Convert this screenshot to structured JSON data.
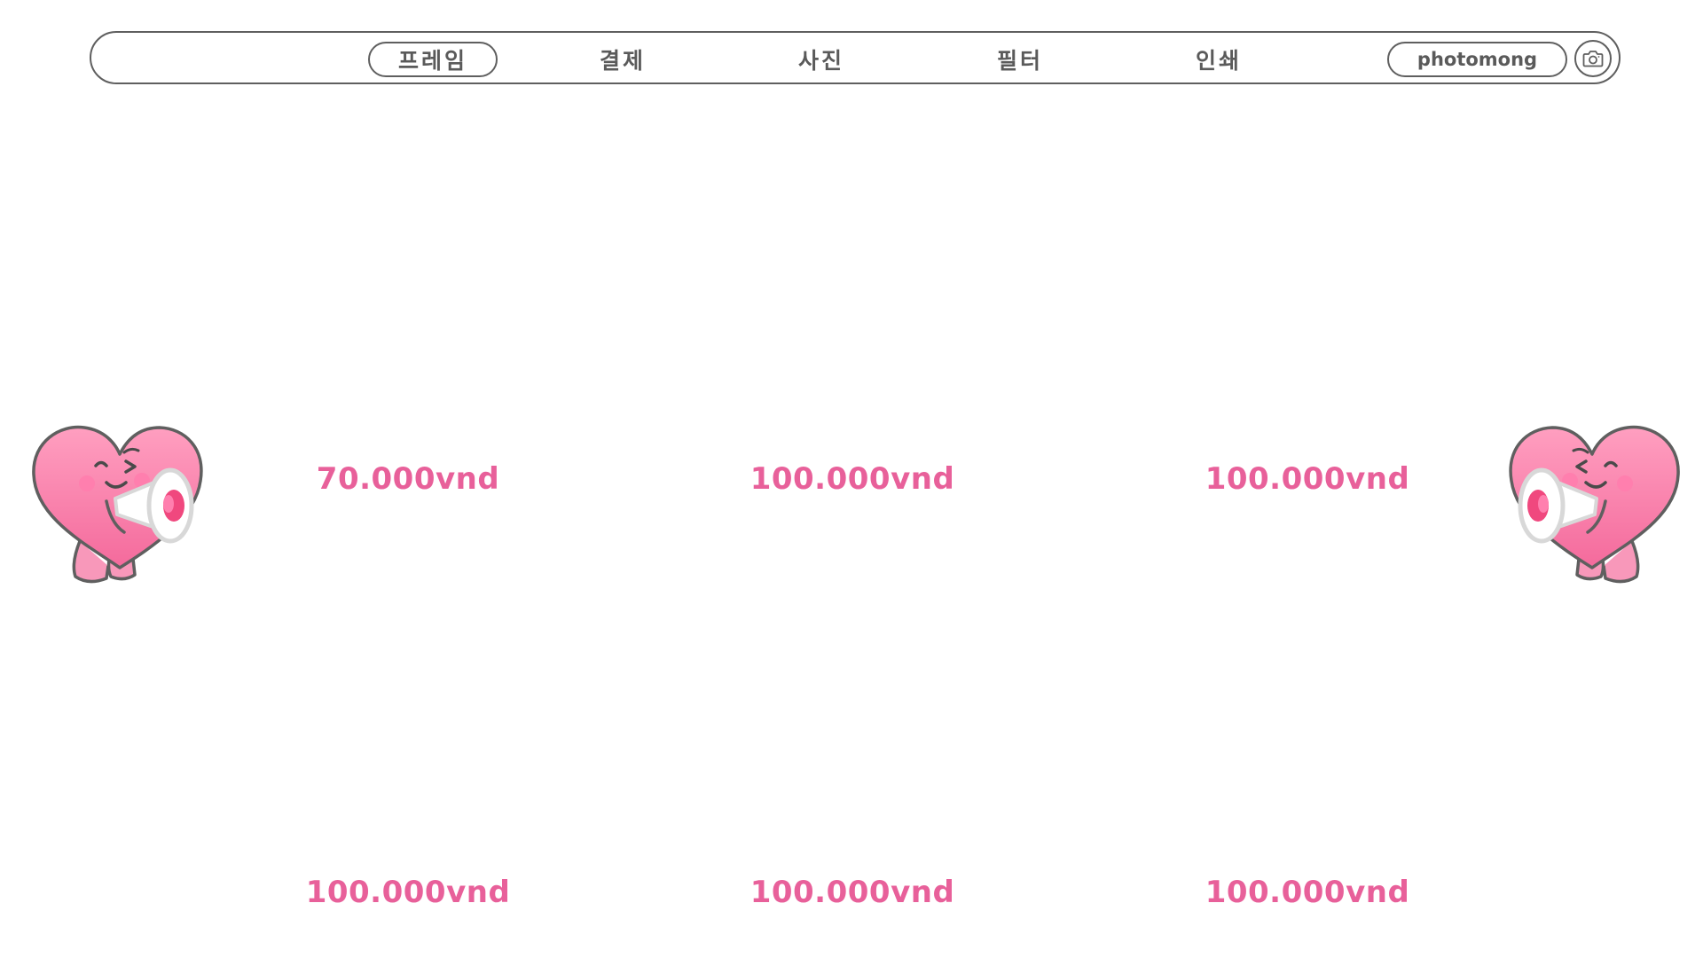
{
  "nav": {
    "tabs": [
      {
        "label": "프레임",
        "active": true
      },
      {
        "label": "결제",
        "active": false
      },
      {
        "label": "사진",
        "active": false
      },
      {
        "label": "필터",
        "active": false
      },
      {
        "label": "인쇄",
        "active": false
      }
    ],
    "brand": "photomong",
    "camera_icon": "camera-icon"
  },
  "frames": [
    {
      "price": "70.000vnd"
    },
    {
      "price": "100.000vnd"
    },
    {
      "price": "100.000vnd"
    },
    {
      "price": "100.000vnd"
    },
    {
      "price": "100.000vnd"
    },
    {
      "price": "100.000vnd"
    }
  ],
  "mascot": {
    "icon": "heart-megaphone-mascot"
  },
  "colors": {
    "price": "#e8609a",
    "outline": "#5f5f5f",
    "heart_top": "#ff9fc0",
    "heart_bottom": "#f46a9c"
  }
}
